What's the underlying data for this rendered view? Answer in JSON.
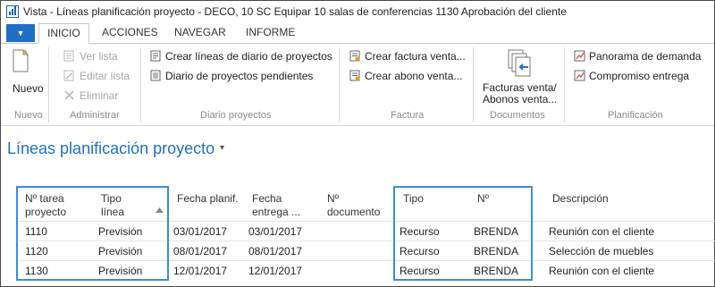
{
  "window": {
    "title": "Vista - Líneas planificación proyecto - DECO, 10 SC Equipar 10 salas de conferencias 1130 Aprobación del cliente"
  },
  "ribbon": {
    "tabs": [
      {
        "label": "INICIO",
        "active": true
      },
      {
        "label": "ACCIONES",
        "active": false
      },
      {
        "label": "NAVEGAR",
        "active": false
      },
      {
        "label": "INFORME",
        "active": false
      }
    ],
    "groups": {
      "nuevo": {
        "label": "Nuevo",
        "button": "Nuevo"
      },
      "administrar": {
        "label": "Administrar",
        "ver": "Ver lista",
        "editar": "Editar lista",
        "eliminar": "Eliminar"
      },
      "diario": {
        "label": "Diario proyectos",
        "crear": "Crear líneas de diario de proyectos",
        "pendientes": "Diario de proyectos pendientes"
      },
      "factura": {
        "label": "Factura",
        "crear_factura": "Crear factura venta...",
        "crear_abono": "Crear abono venta..."
      },
      "documentos": {
        "label": "Documentos",
        "btn_line1": "Facturas venta/",
        "btn_line2": "Abonos venta..."
      },
      "planificacion": {
        "label": "Planificación",
        "panorama": "Panorama de demanda",
        "compromiso": "Compromiso entrega"
      }
    }
  },
  "page": {
    "title": "Líneas planificación proyecto",
    "caret": "▾"
  },
  "table": {
    "headers": {
      "tarea_1": "Nº tarea",
      "tarea_2": "proyecto",
      "tipo_linea_1": "Tipo",
      "tipo_linea_2": "línea",
      "fecha_planif": "Fecha planif.",
      "fecha_entrega_1": "Fecha",
      "fecha_entrega_2": "entrega ...",
      "documento_1": "Nº",
      "documento_2": "documento",
      "tipo": "Tipo",
      "no": "Nº",
      "descripcion": "Descripción"
    },
    "rows": [
      {
        "tarea": "1110",
        "tipo_linea": "Previsión",
        "fecha_planif": "03/01/2017",
        "fecha_entrega": "03/01/2017",
        "documento": "",
        "tipo": "Recurso",
        "no": "BRENDA",
        "descripcion": "Reunión con el cliente"
      },
      {
        "tarea": "1120",
        "tipo_linea": "Previsión",
        "fecha_planif": "08/01/2017",
        "fecha_entrega": "08/01/2017",
        "documento": "",
        "tipo": "Recurso",
        "no": "BRENDA",
        "descripcion": "Selección de muebles"
      },
      {
        "tarea": "1130",
        "tipo_linea": "Previsión",
        "fecha_planif": "12/01/2017",
        "fecha_entrega": "12/01/2017",
        "documento": "",
        "tipo": "Recurso",
        "no": "BRENDA",
        "descripcion": "Reunión con el cliente"
      }
    ]
  },
  "colors": {
    "accent": "#1f6fc5",
    "highlight_border": "#3a8fd6"
  }
}
